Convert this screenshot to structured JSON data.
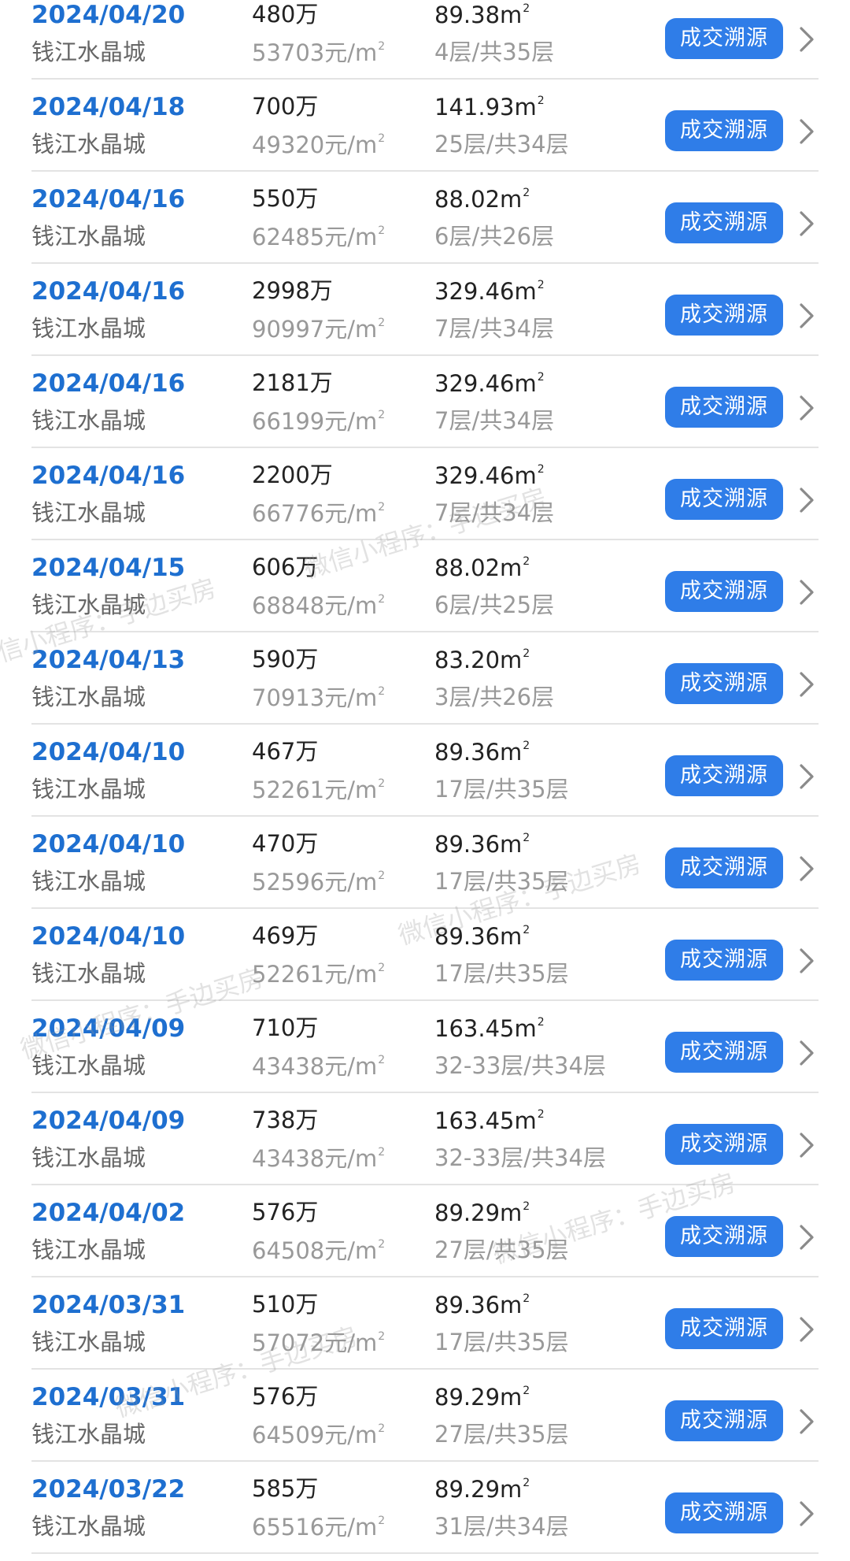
{
  "records": [
    {
      "date": "2024/04/20",
      "community": "钱江水晶城",
      "price": "480万",
      "unit_price": "53703元/m",
      "area": "89.38m",
      "floor": "4层/共35层",
      "button": "成交溯源"
    },
    {
      "date": "2024/04/18",
      "community": "钱江水晶城",
      "price": "700万",
      "unit_price": "49320元/m",
      "area": "141.93m",
      "floor": "25层/共34层",
      "button": "成交溯源"
    },
    {
      "date": "2024/04/16",
      "community": "钱江水晶城",
      "price": "550万",
      "unit_price": "62485元/m",
      "area": "88.02m",
      "floor": "6层/共26层",
      "button": "成交溯源"
    },
    {
      "date": "2024/04/16",
      "community": "钱江水晶城",
      "price": "2998万",
      "unit_price": "90997元/m",
      "area": "329.46m",
      "floor": "7层/共34层",
      "button": "成交溯源"
    },
    {
      "date": "2024/04/16",
      "community": "钱江水晶城",
      "price": "2181万",
      "unit_price": "66199元/m",
      "area": "329.46m",
      "floor": "7层/共34层",
      "button": "成交溯源"
    },
    {
      "date": "2024/04/16",
      "community": "钱江水晶城",
      "price": "2200万",
      "unit_price": "66776元/m",
      "area": "329.46m",
      "floor": "7层/共34层",
      "button": "成交溯源"
    },
    {
      "date": "2024/04/15",
      "community": "钱江水晶城",
      "price": "606万",
      "unit_price": "68848元/m",
      "area": "88.02m",
      "floor": "6层/共25层",
      "button": "成交溯源"
    },
    {
      "date": "2024/04/13",
      "community": "钱江水晶城",
      "price": "590万",
      "unit_price": "70913元/m",
      "area": "83.20m",
      "floor": "3层/共26层",
      "button": "成交溯源"
    },
    {
      "date": "2024/04/10",
      "community": "钱江水晶城",
      "price": "467万",
      "unit_price": "52261元/m",
      "area": "89.36m",
      "floor": "17层/共35层",
      "button": "成交溯源"
    },
    {
      "date": "2024/04/10",
      "community": "钱江水晶城",
      "price": "470万",
      "unit_price": "52596元/m",
      "area": "89.36m",
      "floor": "17层/共35层",
      "button": "成交溯源"
    },
    {
      "date": "2024/04/10",
      "community": "钱江水晶城",
      "price": "469万",
      "unit_price": "52261元/m",
      "area": "89.36m",
      "floor": "17层/共35层",
      "button": "成交溯源"
    },
    {
      "date": "2024/04/09",
      "community": "钱江水晶城",
      "price": "710万",
      "unit_price": "43438元/m",
      "area": "163.45m",
      "floor": "32-33层/共34层",
      "button": "成交溯源"
    },
    {
      "date": "2024/04/09",
      "community": "钱江水晶城",
      "price": "738万",
      "unit_price": "43438元/m",
      "area": "163.45m",
      "floor": "32-33层/共34层",
      "button": "成交溯源"
    },
    {
      "date": "2024/04/02",
      "community": "钱江水晶城",
      "price": "576万",
      "unit_price": "64508元/m",
      "area": "89.29m",
      "floor": "27层/共35层",
      "button": "成交溯源"
    },
    {
      "date": "2024/03/31",
      "community": "钱江水晶城",
      "price": "510万",
      "unit_price": "57072元/m",
      "area": "89.36m",
      "floor": "17层/共35层",
      "button": "成交溯源"
    },
    {
      "date": "2024/03/31",
      "community": "钱江水晶城",
      "price": "576万",
      "unit_price": "64509元/m",
      "area": "89.29m",
      "floor": "27层/共35层",
      "button": "成交溯源"
    },
    {
      "date": "2024/03/22",
      "community": "钱江水晶城",
      "price": "585万",
      "unit_price": "65516元/m",
      "area": "89.29m",
      "floor": "31层/共34层",
      "button": "成交溯源"
    }
  ],
  "superscript": "2",
  "watermark_text": "微信小程序：手边买房",
  "colors": {
    "date": "#1e6fd0",
    "button": "#2f7de8",
    "muted": "#999999"
  },
  "icons": {
    "row_arrow": "chevron-right-icon"
  }
}
